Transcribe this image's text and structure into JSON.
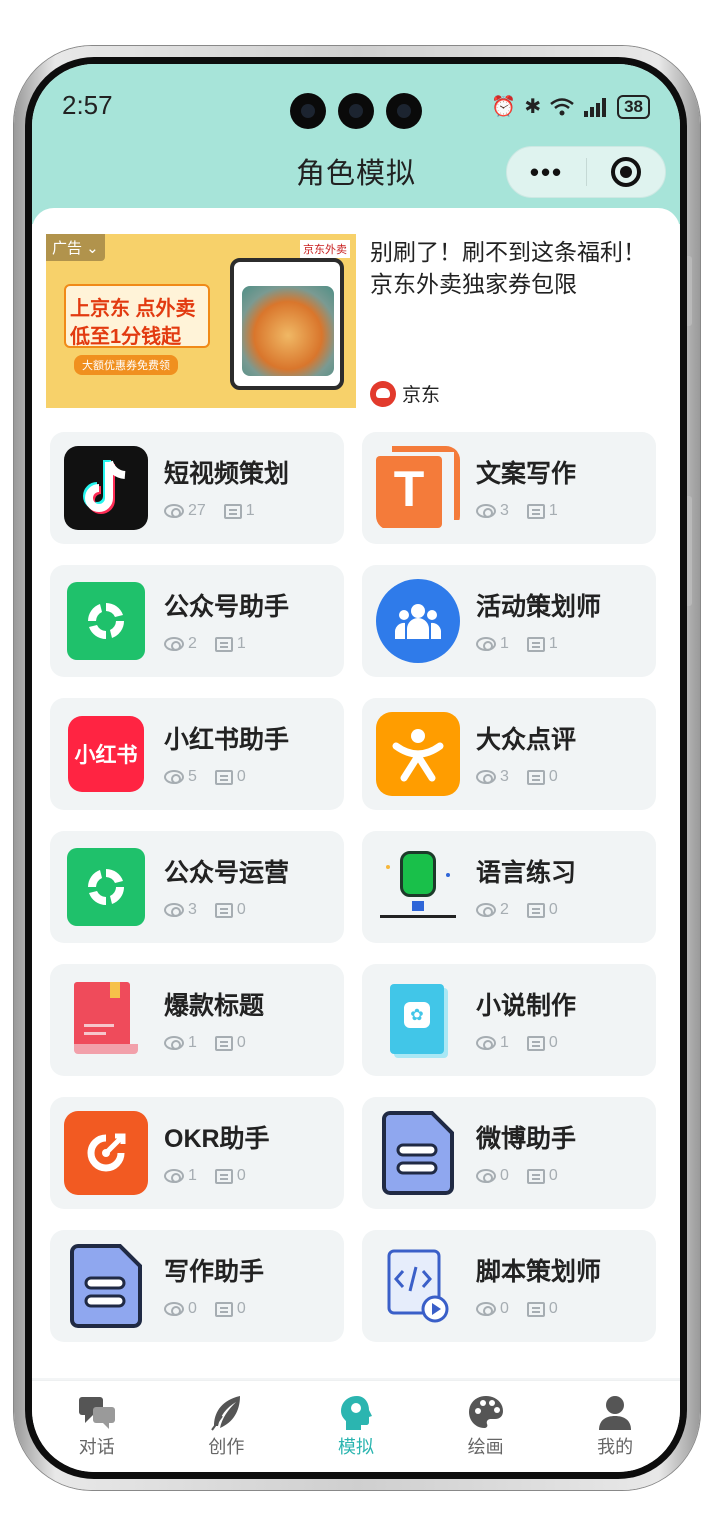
{
  "status_bar": {
    "time": "2:57",
    "battery": "38"
  },
  "nav": {
    "title": "角色模拟"
  },
  "ad": {
    "tag": "广告",
    "brand_badge": "京东外卖",
    "image_line1": "上京东 点外卖",
    "image_line2": "低至1分钱起",
    "image_pill": "大额优惠券免费领",
    "text": "别刷了！刷不到这条福利！京东外卖独家券包限",
    "source": "京东"
  },
  "cards": [
    {
      "title": "短视频策划",
      "views": "27",
      "comments": "1",
      "icon": "tiktok-icon"
    },
    {
      "title": "文案写作",
      "views": "3",
      "comments": "1",
      "icon": "text-t-icon"
    },
    {
      "title": "公众号助手",
      "views": "2",
      "comments": "1",
      "icon": "wechat-official-icon"
    },
    {
      "title": "活动策划师",
      "views": "1",
      "comments": "1",
      "icon": "group-people-icon"
    },
    {
      "title": "小红书助手",
      "views": "5",
      "comments": "0",
      "icon": "xiaohongshu-icon"
    },
    {
      "title": "大众点评",
      "views": "3",
      "comments": "0",
      "icon": "dianping-icon"
    },
    {
      "title": "公众号运营",
      "views": "3",
      "comments": "0",
      "icon": "wechat-official-icon"
    },
    {
      "title": "语言练习",
      "views": "2",
      "comments": "0",
      "icon": "microphone-icon"
    },
    {
      "title": "爆款标题",
      "views": "1",
      "comments": "0",
      "icon": "red-book-icon"
    },
    {
      "title": "小说制作",
      "views": "1",
      "comments": "0",
      "icon": "novel-book-icon"
    },
    {
      "title": "OKR助手",
      "views": "1",
      "comments": "0",
      "icon": "target-arrow-icon"
    },
    {
      "title": "微博助手",
      "views": "0",
      "comments": "0",
      "icon": "document-icon"
    },
    {
      "title": "写作助手",
      "views": "0",
      "comments": "0",
      "icon": "document-icon"
    },
    {
      "title": "脚本策划师",
      "views": "0",
      "comments": "0",
      "icon": "code-file-icon"
    }
  ],
  "tabs": [
    {
      "label": "对话",
      "icon": "chat-bubbles-icon"
    },
    {
      "label": "创作",
      "icon": "feather-icon"
    },
    {
      "label": "模拟",
      "icon": "head-profile-icon",
      "active": true
    },
    {
      "label": "绘画",
      "icon": "palette-icon"
    },
    {
      "label": "我的",
      "icon": "user-icon"
    }
  ],
  "colors": {
    "accent": "#2bb5b0",
    "header": "#a7e4d9"
  }
}
